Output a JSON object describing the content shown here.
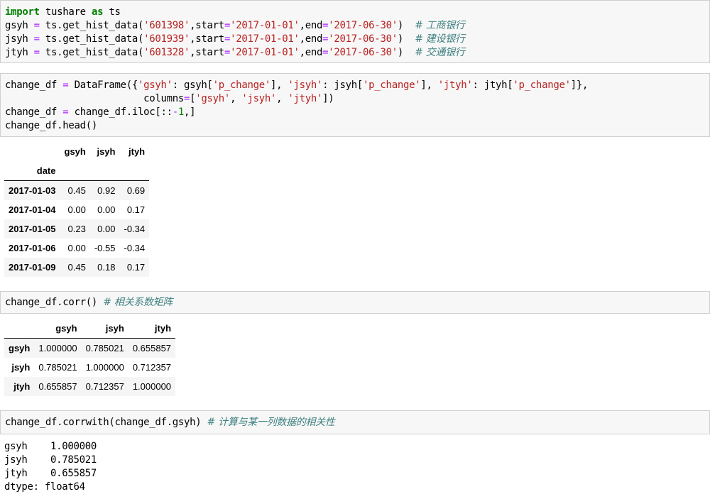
{
  "cells": [
    {
      "lines": [
        [
          [
            "kw",
            "import"
          ],
          [
            "p",
            " tushare "
          ],
          [
            "kw",
            "as"
          ],
          [
            "p",
            " ts"
          ]
        ],
        [
          [
            "p",
            "gsyh "
          ],
          [
            "op",
            "="
          ],
          [
            "p",
            " ts.get_hist_data("
          ],
          [
            "str",
            "'601398'"
          ],
          [
            "p",
            ",start"
          ],
          [
            "op",
            "="
          ],
          [
            "str",
            "'2017-01-01'"
          ],
          [
            "p",
            ",end"
          ],
          [
            "op",
            "="
          ],
          [
            "str",
            "'2017-06-30'"
          ],
          [
            "p",
            ")  "
          ],
          [
            "cm",
            "# 工商银行"
          ]
        ],
        [
          [
            "p",
            "jsyh "
          ],
          [
            "op",
            "="
          ],
          [
            "p",
            " ts.get_hist_data("
          ],
          [
            "str",
            "'601939'"
          ],
          [
            "p",
            ",start"
          ],
          [
            "op",
            "="
          ],
          [
            "str",
            "'2017-01-01'"
          ],
          [
            "p",
            ",end"
          ],
          [
            "op",
            "="
          ],
          [
            "str",
            "'2017-06-30'"
          ],
          [
            "p",
            ")  "
          ],
          [
            "cm",
            "# 建设银行"
          ]
        ],
        [
          [
            "p",
            "jtyh "
          ],
          [
            "op",
            "="
          ],
          [
            "p",
            " ts.get_hist_data("
          ],
          [
            "str",
            "'601328'"
          ],
          [
            "p",
            ",start"
          ],
          [
            "op",
            "="
          ],
          [
            "str",
            "'2017-01-01'"
          ],
          [
            "p",
            ",end"
          ],
          [
            "op",
            "="
          ],
          [
            "str",
            "'2017-06-30'"
          ],
          [
            "p",
            ")  "
          ],
          [
            "cm",
            "# 交通银行"
          ]
        ]
      ]
    },
    {
      "lines": [
        [
          [
            "p",
            "change_df "
          ],
          [
            "op",
            "="
          ],
          [
            "p",
            " DataFrame({"
          ],
          [
            "str",
            "'gsyh'"
          ],
          [
            "p",
            ": gsyh["
          ],
          [
            "str",
            "'p_change'"
          ],
          [
            "p",
            "], "
          ],
          [
            "str",
            "'jsyh'"
          ],
          [
            "p",
            ": jsyh["
          ],
          [
            "str",
            "'p_change'"
          ],
          [
            "p",
            "], "
          ],
          [
            "str",
            "'jtyh'"
          ],
          [
            "p",
            ": jtyh["
          ],
          [
            "str",
            "'p_change'"
          ],
          [
            "p",
            "]},"
          ]
        ],
        [
          [
            "p",
            "                        columns"
          ],
          [
            "op",
            "="
          ],
          [
            "p",
            "["
          ],
          [
            "str",
            "'gsyh'"
          ],
          [
            "p",
            ", "
          ],
          [
            "str",
            "'jsyh'"
          ],
          [
            "p",
            ", "
          ],
          [
            "str",
            "'jtyh'"
          ],
          [
            "p",
            "])"
          ]
        ],
        [
          [
            "p",
            "change_df "
          ],
          [
            "op",
            "="
          ],
          [
            "p",
            " change_df.iloc[::"
          ],
          [
            "op",
            "-"
          ],
          [
            "num",
            "1"
          ],
          [
            "p",
            ",]"
          ]
        ],
        [
          [
            "p",
            "change_df.head()"
          ]
        ]
      ]
    },
    {
      "lines": [
        [
          [
            "p",
            "change_df.corr() "
          ],
          [
            "cm",
            "# 相关系数矩阵"
          ]
        ]
      ]
    },
    {
      "lines": [
        [
          [
            "p",
            "change_df.corrwith(change_df.gsyh) "
          ],
          [
            "cm",
            "# 计算与某一列数据的相关性"
          ]
        ]
      ]
    }
  ],
  "head_table": {
    "columns": [
      "gsyh",
      "jsyh",
      "jtyh"
    ],
    "index_name": "date",
    "rows": [
      {
        "index": "2017-01-03",
        "values": [
          "0.45",
          "0.92",
          "0.69"
        ]
      },
      {
        "index": "2017-01-04",
        "values": [
          "0.00",
          "0.00",
          "0.17"
        ]
      },
      {
        "index": "2017-01-05",
        "values": [
          "0.23",
          "0.00",
          "-0.34"
        ]
      },
      {
        "index": "2017-01-06",
        "values": [
          "0.00",
          "-0.55",
          "-0.34"
        ]
      },
      {
        "index": "2017-01-09",
        "values": [
          "0.45",
          "0.18",
          "0.17"
        ]
      }
    ]
  },
  "corr_table": {
    "columns": [
      "gsyh",
      "jsyh",
      "jtyh"
    ],
    "rows": [
      {
        "index": "gsyh",
        "values": [
          "1.000000",
          "0.785021",
          "0.655857"
        ]
      },
      {
        "index": "jsyh",
        "values": [
          "0.785021",
          "1.000000",
          "0.712357"
        ]
      },
      {
        "index": "jtyh",
        "values": [
          "0.655857",
          "0.712357",
          "1.000000"
        ]
      }
    ]
  },
  "corrwith_output": [
    "gsyh    1.000000",
    "jsyh    0.785021",
    "jtyh    0.655857",
    "dtype: float64"
  ]
}
